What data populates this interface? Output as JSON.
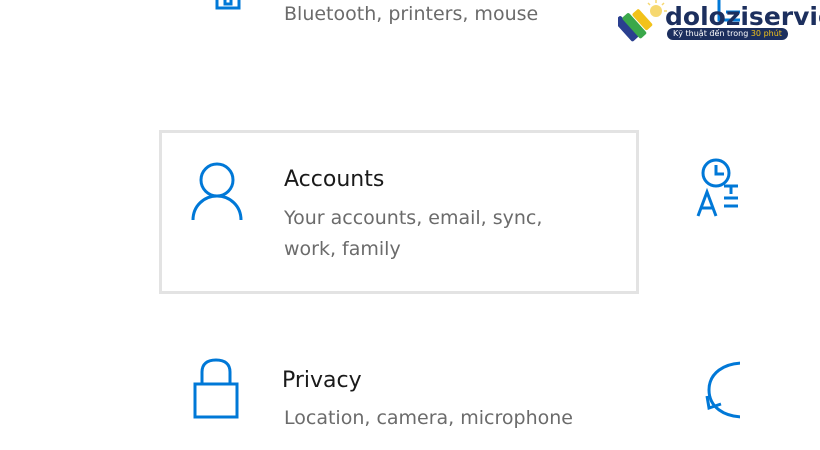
{
  "categories": [
    {
      "id": "devices",
      "title": "",
      "description_lines": [
        "Bluetooth, printers, mouse"
      ],
      "icon": "devices-icon"
    },
    {
      "id": "accounts",
      "title": "Accounts",
      "description_lines": [
        "Your accounts, email, sync,",
        "work, family"
      ],
      "icon": "person-icon"
    },
    {
      "id": "privacy",
      "title": "Privacy",
      "description_lines": [
        "Location, camera, microphone"
      ],
      "icon": "lock-icon"
    }
  ],
  "right_column_icons": [
    "phone-icon",
    "time-language-icon",
    "update-security-icon"
  ],
  "watermark": {
    "brand": "doloziservice",
    "tagline_prefix": "Kỹ thuật đến trong ",
    "tagline_highlight": "30 phút"
  },
  "colors": {
    "accent": "#0078d7",
    "title_text": "#1a1a1a",
    "description_text": "#6b6b6b",
    "tile_border": "#e3e3e3",
    "watermark_navy": "#1c2f5e",
    "watermark_yellow": "#f2c21a"
  }
}
